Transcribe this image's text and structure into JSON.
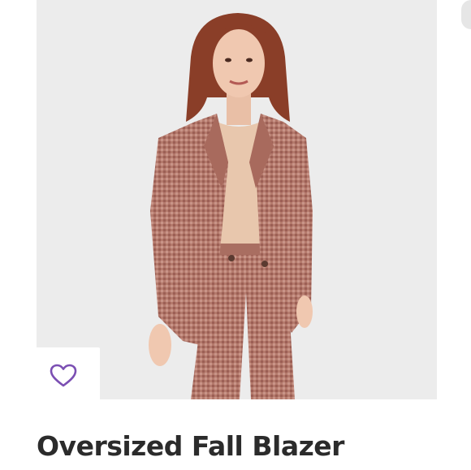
{
  "product": {
    "title": "Oversized Fall Blazer",
    "image_icon": "product-photo",
    "favorite_icon": "heart-outline-icon"
  },
  "colors": {
    "heart": "#7b4fb3",
    "title_text": "#2b2b2b",
    "photo_background": "#ececec",
    "blazer": "#b47a6c"
  }
}
